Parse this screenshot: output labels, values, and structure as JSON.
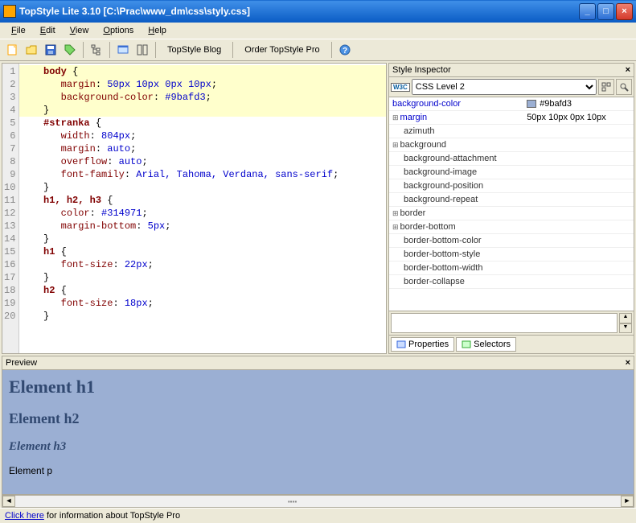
{
  "window": {
    "title": "TopStyle Lite 3.10 [C:\\Prac\\www_dm\\css\\styly.css]"
  },
  "menus": [
    "File",
    "Edit",
    "View",
    "Options",
    "Help"
  ],
  "toolbar": {
    "blog": "TopStyle Blog",
    "order": "Order TopStyle Pro"
  },
  "code": {
    "lines": [
      {
        "n": 1,
        "hl": true,
        "seg": [
          [
            "kwsel",
            "body"
          ],
          [
            "",
            ". {"
          ]
        ],
        "raw": "body {"
      },
      {
        "n": 2,
        "hl": true,
        "raw": "   margin: 50px 10px 0px 10px;"
      },
      {
        "n": 3,
        "hl": true,
        "raw": "   background-color: #9bafd3;"
      },
      {
        "n": 4,
        "hl": true,
        "raw": "}"
      },
      {
        "n": 5,
        "raw": "#stranka {"
      },
      {
        "n": 6,
        "raw": "   width: 804px;"
      },
      {
        "n": 7,
        "raw": "   margin: auto;"
      },
      {
        "n": 8,
        "raw": "   overflow: auto;"
      },
      {
        "n": 9,
        "raw": "   font-family: Arial, Tahoma, Verdana, sans-serif;"
      },
      {
        "n": 10,
        "raw": "}"
      },
      {
        "n": 11,
        "raw": "h1, h2, h3 {"
      },
      {
        "n": 12,
        "raw": "   color: #314971;"
      },
      {
        "n": 13,
        "raw": "   margin-bottom: 5px;"
      },
      {
        "n": 14,
        "raw": "}"
      },
      {
        "n": 15,
        "raw": "h1 {"
      },
      {
        "n": 16,
        "raw": "   font-size: 22px;"
      },
      {
        "n": 17,
        "raw": "}"
      },
      {
        "n": 18,
        "raw": "h2 {"
      },
      {
        "n": 19,
        "raw": "   font-size: 18px;"
      },
      {
        "n": 20,
        "raw": "}"
      }
    ]
  },
  "inspector": {
    "title": "Style Inspector",
    "level": "CSS Level 2",
    "props": [
      {
        "name": "background-color",
        "val": "#9bafd3",
        "sel": true,
        "swatch": "#9bafd3"
      },
      {
        "name": "margin",
        "val": "50px 10px 0px 10px",
        "sel": true,
        "exp": true
      },
      {
        "name": "azimuth",
        "child": true
      },
      {
        "name": "background",
        "exp": true
      },
      {
        "name": "background-attachment",
        "child": true
      },
      {
        "name": "background-image",
        "child": true
      },
      {
        "name": "background-position",
        "child": true
      },
      {
        "name": "background-repeat",
        "child": true
      },
      {
        "name": "border",
        "exp": true
      },
      {
        "name": "border-bottom",
        "exp": true
      },
      {
        "name": "border-bottom-color",
        "child": true
      },
      {
        "name": "border-bottom-style",
        "child": true
      },
      {
        "name": "border-bottom-width",
        "child": true
      },
      {
        "name": "border-collapse",
        "child": true
      }
    ],
    "tabs": {
      "properties": "Properties",
      "selectors": "Selectors"
    }
  },
  "preview": {
    "title": "Preview",
    "h1": "Element h1",
    "h2": "Element h2",
    "h3": "Element h3",
    "p": "Element p"
  },
  "status": {
    "link": "Click here",
    "text": " for information about TopStyle Pro"
  }
}
